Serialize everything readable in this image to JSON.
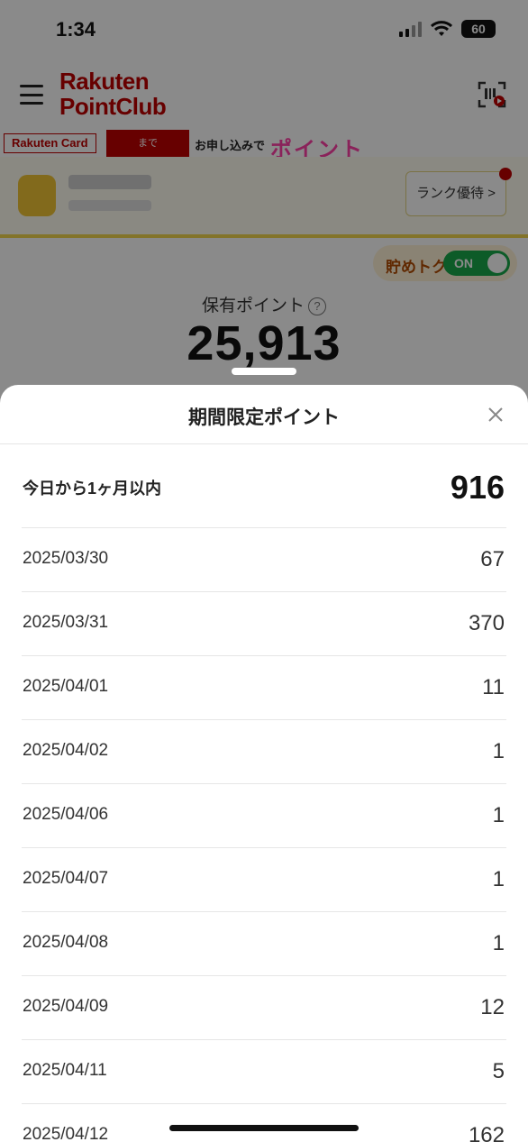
{
  "status_bar": {
    "time": "1:34",
    "battery": "60"
  },
  "header": {
    "logo_line1": "Rakuten",
    "logo_line2": "PointClub"
  },
  "banner": {
    "card_label": "Rakuten Card",
    "deadline": "まで",
    "text": "お申し込みで",
    "promo": "ポイント"
  },
  "rank": {
    "button_label": "ランク優待 >"
  },
  "savings_toggle": {
    "label": "貯めトク",
    "state": "ON"
  },
  "points": {
    "label": "保有ポイント",
    "help": "?",
    "value": "25,913"
  },
  "sheet": {
    "title": "期間限定ポイント",
    "summary_label": "今日から1ヶ月以内",
    "summary_value": "916",
    "rows": [
      {
        "date": "2025/03/30",
        "value": "67"
      },
      {
        "date": "2025/03/31",
        "value": "370"
      },
      {
        "date": "2025/04/01",
        "value": "11"
      },
      {
        "date": "2025/04/02",
        "value": "1"
      },
      {
        "date": "2025/04/06",
        "value": "1"
      },
      {
        "date": "2025/04/07",
        "value": "1"
      },
      {
        "date": "2025/04/08",
        "value": "1"
      },
      {
        "date": "2025/04/09",
        "value": "12"
      },
      {
        "date": "2025/04/11",
        "value": "5"
      },
      {
        "date": "2025/04/12",
        "value": "162"
      }
    ]
  },
  "colors": {
    "brand": "#bf0000",
    "toggle_on": "#18a84a",
    "overlay": "rgba(0,0,0,0.46)"
  },
  "icons": [
    "menu-icon",
    "scan-icon",
    "help-icon",
    "close-icon"
  ]
}
